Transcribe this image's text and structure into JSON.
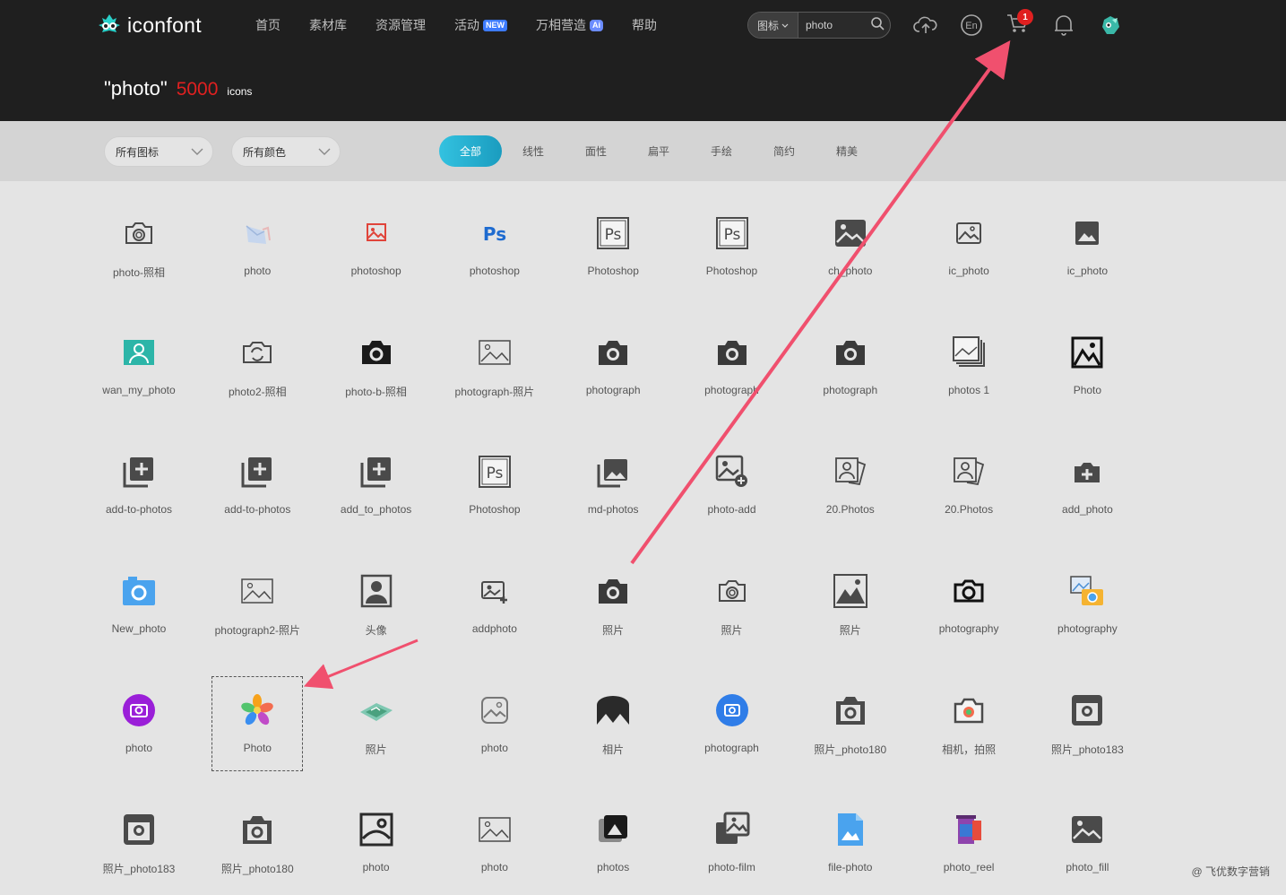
{
  "header": {
    "logo_text": "iconfont",
    "nav": [
      {
        "label": "首页"
      },
      {
        "label": "素材库"
      },
      {
        "label": "资源管理"
      },
      {
        "label": "活动",
        "badge": "NEW"
      },
      {
        "label": "万相营造",
        "badge": "Ai"
      },
      {
        "label": "帮助"
      }
    ],
    "search": {
      "type_label": "图标",
      "query": "photo"
    },
    "cart_count": "1",
    "language_icon_text": "En"
  },
  "results": {
    "query": "\"photo\"",
    "count": "5000",
    "unit": "icons"
  },
  "filters": {
    "type_dropdown": "所有图标",
    "color_dropdown": "所有颜色",
    "style_tabs": [
      "全部",
      "线性",
      "面性",
      "扁平",
      "手绘",
      "简约",
      "精美"
    ],
    "active_style": "全部"
  },
  "icons": [
    [
      {
        "label": "photo-照相",
        "icon": "camera-outline-icon"
      },
      {
        "label": "photo",
        "icon": "photo-envelope-icon"
      },
      {
        "label": "photoshop",
        "icon": "image-red-icon"
      },
      {
        "label": "photoshop",
        "icon": "ps-blue-icon"
      },
      {
        "label": "Photoshop",
        "icon": "ps-outline-icon"
      },
      {
        "label": "Photoshop",
        "icon": "ps-outline-icon"
      },
      {
        "label": "ch_photo",
        "icon": "image-filled-icon"
      },
      {
        "label": "ic_photo",
        "icon": "image-outline-icon"
      },
      {
        "label": "ic_photo",
        "icon": "image-filled-small-icon"
      }
    ],
    [
      {
        "label": "wan_my_photo",
        "icon": "user-photo-teal-icon"
      },
      {
        "label": "photo2-照相",
        "icon": "camera-switch-icon"
      },
      {
        "label": "photo-b-照相",
        "icon": "camera-black-icon"
      },
      {
        "label": "photograph-照片",
        "icon": "image-thin-icon"
      },
      {
        "label": "photograph",
        "icon": "camera-filled-icon"
      },
      {
        "label": "photograph",
        "icon": "camera-filled-icon"
      },
      {
        "label": "photograph",
        "icon": "camera-filled-icon"
      },
      {
        "label": "photos 1",
        "icon": "photos-stack-icon"
      },
      {
        "label": "Photo",
        "icon": "image-frame-icon"
      }
    ],
    [
      {
        "label": "add-to-photos",
        "icon": "add-photos-icon"
      },
      {
        "label": "add-to-photos",
        "icon": "add-photos-icon"
      },
      {
        "label": "add_to_photos",
        "icon": "add-photos-icon"
      },
      {
        "label": "Photoshop",
        "icon": "ps-outline-icon"
      },
      {
        "label": "md-photos",
        "icon": "photos-filled-icon"
      },
      {
        "label": "photo-add",
        "icon": "photo-add-icon"
      },
      {
        "label": "20.Photos",
        "icon": "portrait-photos-icon"
      },
      {
        "label": "20.Photos",
        "icon": "portrait-photos-icon"
      },
      {
        "label": "add_photo",
        "icon": "add-camera-icon"
      }
    ],
    [
      {
        "label": "New_photo",
        "icon": "camera-blue-icon"
      },
      {
        "label": "photograph2-照片",
        "icon": "image-thin-icon"
      },
      {
        "label": "头像",
        "icon": "avatar-frame-icon"
      },
      {
        "label": "addphoto",
        "icon": "add-image-icon"
      },
      {
        "label": "照片",
        "icon": "camera-filled-icon"
      },
      {
        "label": "照片",
        "icon": "camera-outline-icon"
      },
      {
        "label": "照片",
        "icon": "mountain-frame-icon"
      },
      {
        "label": "photography",
        "icon": "camera-outline-bold-icon"
      },
      {
        "label": "photography",
        "icon": "color-photo-camera-icon"
      }
    ],
    [
      {
        "label": "photo",
        "icon": "camera-purple-circle-icon"
      },
      {
        "label": "Photo",
        "icon": "flower-photos-icon"
      },
      {
        "label": "照片",
        "icon": "map-photo-icon"
      },
      {
        "label": "photo",
        "icon": "image-rounded-icon"
      },
      {
        "label": "相片",
        "icon": "mountain-dark-icon"
      },
      {
        "label": "photograph",
        "icon": "camera-blue-circle-icon"
      },
      {
        "label": "照片_photo180",
        "icon": "camera-square-icon"
      },
      {
        "label": "相机，拍照",
        "icon": "camera-color-lens-icon"
      },
      {
        "label": "照片_photo183",
        "icon": "instagram-like-icon"
      }
    ],
    [
      {
        "label": "照片_photo183",
        "icon": "instagram-like-icon"
      },
      {
        "label": "照片_photo180",
        "icon": "camera-square-icon"
      },
      {
        "label": "photo",
        "icon": "image-doc-icon"
      },
      {
        "label": "photo",
        "icon": "image-thin-icon"
      },
      {
        "label": "photos",
        "icon": "photos-dark-icon"
      },
      {
        "label": "photo-film",
        "icon": "photo-film-icon"
      },
      {
        "label": "file-photo",
        "icon": "file-photo-blue-icon"
      },
      {
        "label": "photo_reel",
        "icon": "photo-reel-icon"
      },
      {
        "label": "photo_fill",
        "icon": "image-filled-icon"
      }
    ]
  ],
  "watermark": "@ 飞优数字营销",
  "colors": {
    "header_bg": "#1f1f1f",
    "accent_red": "#e02020",
    "active_tab": "#22acd0",
    "arrow": "#f0506e"
  }
}
